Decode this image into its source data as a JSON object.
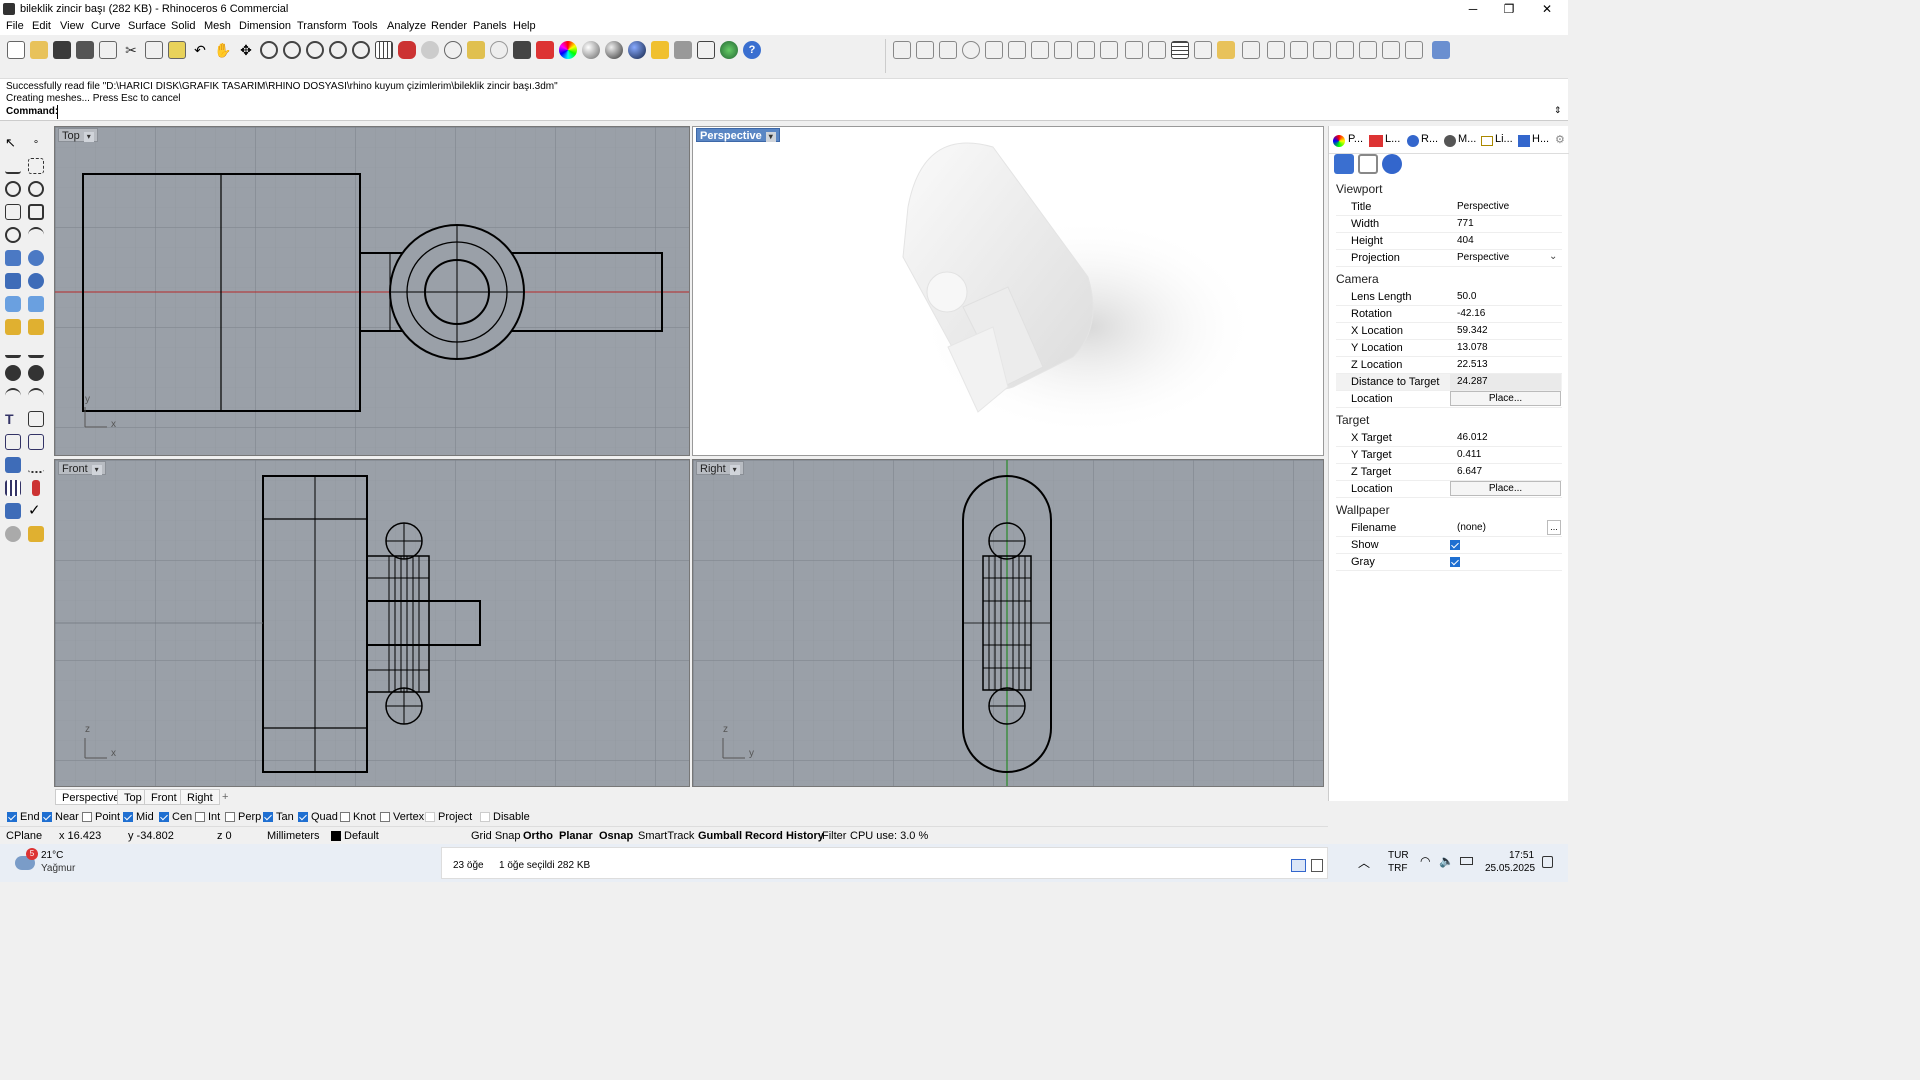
{
  "window": {
    "title": "bileklik zincir başı (282 KB) - Rhinoceros 6 Commercial",
    "minimize": "─",
    "maximize": "❐",
    "close": "✕"
  },
  "menu": [
    "File",
    "Edit",
    "View",
    "Curve",
    "Surface",
    "Solid",
    "Mesh",
    "Dimension",
    "Transform",
    "Tools",
    "Analyze",
    "Render",
    "Panels",
    "Help"
  ],
  "command": {
    "line1": "Successfully read file \"D:\\HARICI DISK\\GRAFIK TASARIM\\RHINO DOSYASI\\rhino kuyum çizimlerim\\bileklik zincir başı.3dm\"",
    "line2": "Creating meshes... Press Esc to cancel",
    "prompt": "Command:"
  },
  "viewports": {
    "top": {
      "label": "Top",
      "axis_x": "x",
      "axis_y": "y"
    },
    "perspective": {
      "label": "Perspective"
    },
    "front": {
      "label": "Front",
      "axis_x": "x",
      "axis_y": "z"
    },
    "right": {
      "label": "Right",
      "axis_x": "y",
      "axis_y": "z"
    }
  },
  "viewport_tabs": [
    "Perspective",
    "Top",
    "Front",
    "Right",
    "+"
  ],
  "osnap": [
    {
      "label": "End",
      "checked": true
    },
    {
      "label": "Near",
      "checked": true
    },
    {
      "label": "Point",
      "checked": false
    },
    {
      "label": "Mid",
      "checked": true
    },
    {
      "label": "Cen",
      "checked": true
    },
    {
      "label": "Int",
      "checked": false
    },
    {
      "label": "Perp",
      "checked": false
    },
    {
      "label": "Tan",
      "checked": true
    },
    {
      "label": "Quad",
      "checked": true
    },
    {
      "label": "Knot",
      "checked": false
    },
    {
      "label": "Vertex",
      "checked": false
    },
    {
      "label": "Project",
      "checked": false
    },
    {
      "label": "Disable",
      "checked": false
    }
  ],
  "status": {
    "cplane": "CPlane",
    "x": "x 16.423",
    "y": "y -34.802",
    "z": "z 0",
    "units": "Millimeters",
    "layer": "Default",
    "grid_snap": "Grid Snap",
    "ortho": "Ortho",
    "planar": "Planar",
    "osnap": "Osnap",
    "smarttrack": "SmartTrack",
    "gumball": "Gumball",
    "record_history": "Record History",
    "filter": "Filter",
    "cpu": "CPU use: 3.0 %"
  },
  "panel": {
    "tabs": [
      "P...",
      "L...",
      "R...",
      "M...",
      "Li...",
      "H..."
    ],
    "viewport_section": "Viewport",
    "viewport": [
      {
        "label": "Title",
        "value": "Perspective"
      },
      {
        "label": "Width",
        "value": "771"
      },
      {
        "label": "Height",
        "value": "404"
      },
      {
        "label": "Projection",
        "value": "Perspective"
      }
    ],
    "camera_section": "Camera",
    "camera": [
      {
        "label": "Lens Length",
        "value": "50.0"
      },
      {
        "label": "Rotation",
        "value": "-42.16"
      },
      {
        "label": "X Location",
        "value": "59.342"
      },
      {
        "label": "Y Location",
        "value": "13.078"
      },
      {
        "label": "Z Location",
        "value": "22.513"
      },
      {
        "label": "Distance to Target",
        "value": "24.287"
      }
    ],
    "camera_location": {
      "label": "Location",
      "button": "Place..."
    },
    "target_section": "Target",
    "target": [
      {
        "label": "X Target",
        "value": "46.012"
      },
      {
        "label": "Y Target",
        "value": "0.411"
      },
      {
        "label": "Z Target",
        "value": "6.647"
      }
    ],
    "target_location": {
      "label": "Location",
      "button": "Place..."
    },
    "wallpaper_section": "Wallpaper",
    "wallpaper_filename": {
      "label": "Filename",
      "value": "(none)",
      "button": "..."
    },
    "wallpaper_show": {
      "label": "Show",
      "checked": true
    },
    "wallpaper_gray": {
      "label": "Gray",
      "checked": true
    }
  },
  "taskbar": {
    "weather_badge": "5",
    "temp": "21°C",
    "condition": "Yağmur",
    "objects": "23 öğe",
    "selected": "1 öğe seçildi  282 KB",
    "lang1": "TUR",
    "lang2": "TRF",
    "time": "17:51",
    "date": "25.05.2025"
  }
}
